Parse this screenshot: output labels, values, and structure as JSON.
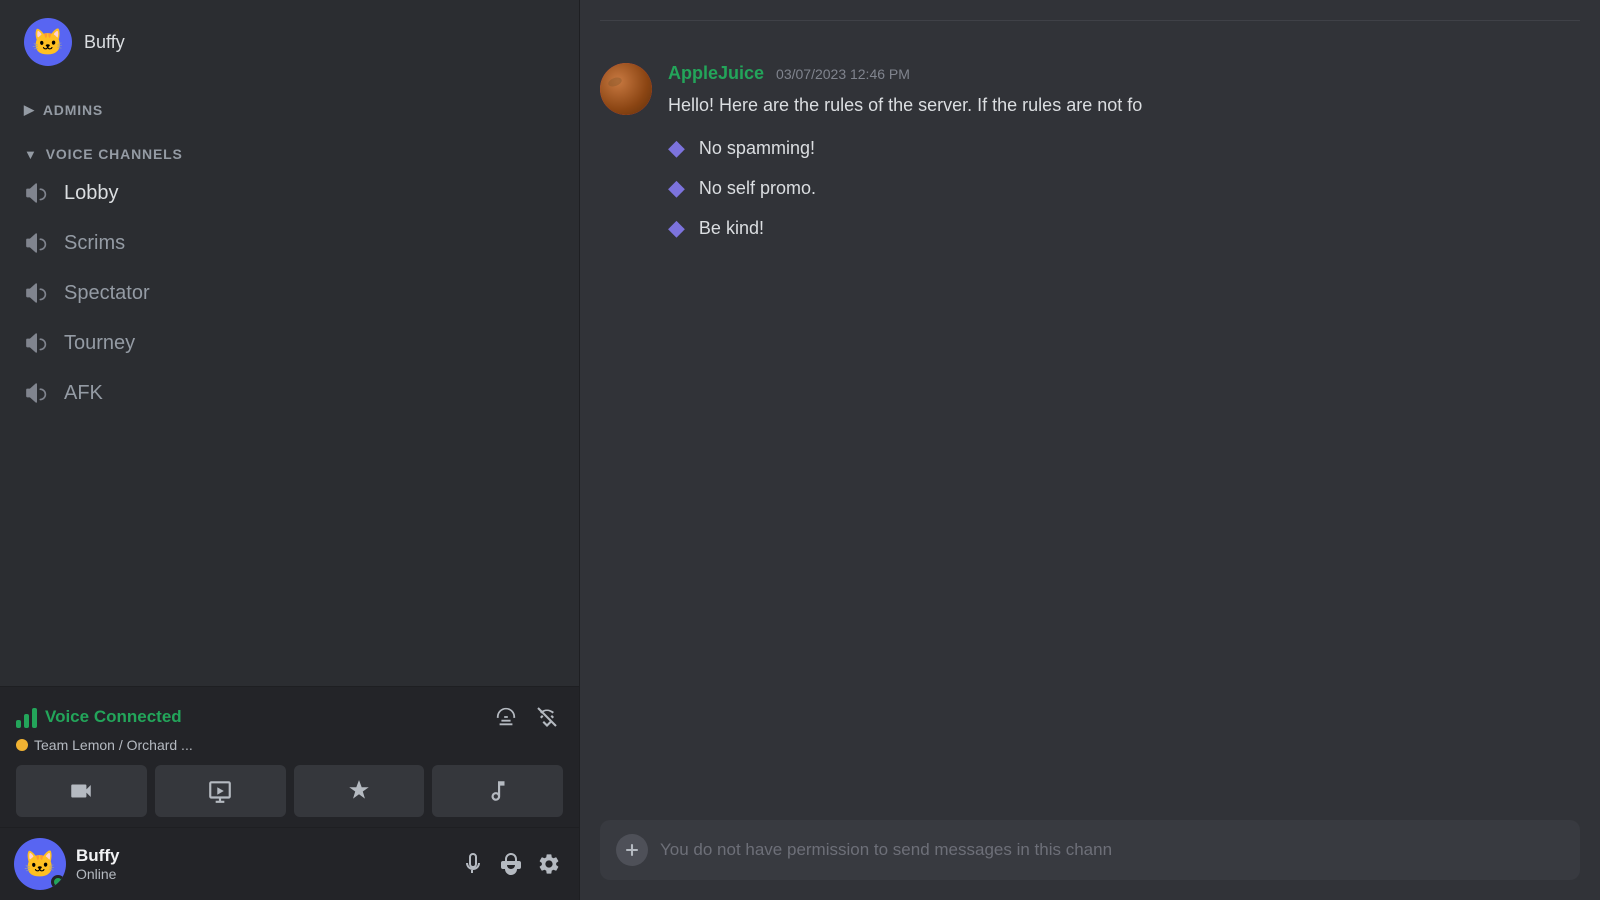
{
  "sidebar": {
    "top_user": {
      "name": "Buffy",
      "avatar_emoji": "🐱"
    },
    "admins_section": {
      "label": "ADMINS",
      "collapsed": false
    },
    "voice_channels_section": {
      "label": "VOICE CHANNELS",
      "collapsed": false
    },
    "channels": [
      {
        "id": "lobby",
        "name": "Lobby"
      },
      {
        "id": "scrims",
        "name": "Scrims"
      },
      {
        "id": "spectator",
        "name": "Spectator"
      },
      {
        "id": "tourney",
        "name": "Tourney"
      },
      {
        "id": "afk",
        "name": "AFK"
      }
    ],
    "voice_connected": {
      "title": "Voice Connected",
      "subtitle": "Team Lemon / Orchard ...",
      "dot_color": "#f0b232"
    },
    "user": {
      "name": "Buffy",
      "status": "Online",
      "status_color": "#23a55a"
    }
  },
  "chat": {
    "message": {
      "author": "AppleJuice",
      "timestamp": "03/07/2023 12:46 PM",
      "text": "Hello! Here are the rules of the server. If the rules are not fo",
      "rules": [
        "No spamming!",
        "No self promo.",
        "Be kind!"
      ]
    },
    "input_placeholder": "You do not have permission to send messages in this chann"
  },
  "icons": {
    "voice_bars": "voice-bars",
    "disconnect": "✕",
    "camera": "📷",
    "screen_share": "🖥",
    "activity": "🚀",
    "music": "🎵",
    "microphone": "🎤",
    "headphones": "🎧",
    "settings": "⚙",
    "plus": "+"
  }
}
